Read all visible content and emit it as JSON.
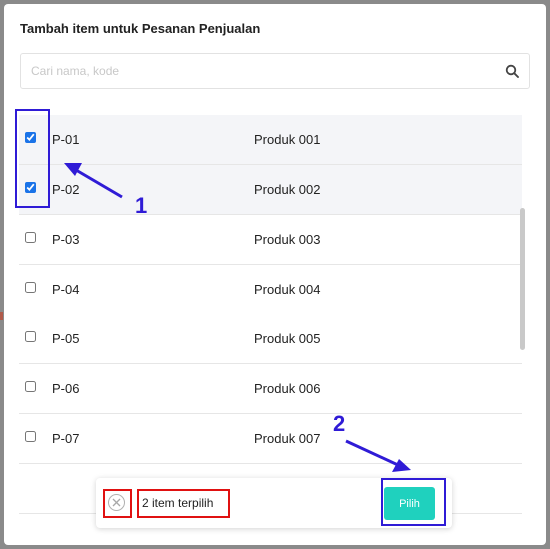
{
  "modal": {
    "title": "Tambah item untuk Pesanan Penjualan",
    "search": {
      "placeholder": "Cari nama, kode",
      "value": ""
    },
    "search_icon": "search-icon"
  },
  "items": [
    {
      "code": "P-01",
      "name": "Produk 001",
      "checked": true
    },
    {
      "code": "P-02",
      "name": "Produk 002",
      "checked": true
    },
    {
      "code": "P-03",
      "name": "Produk 003",
      "checked": false
    },
    {
      "code": "P-04",
      "name": "Produk 004",
      "checked": false
    },
    {
      "code": "P-05",
      "name": "Produk 005",
      "checked": false
    },
    {
      "code": "P-06",
      "name": "Produk 006",
      "checked": false
    },
    {
      "code": "P-07",
      "name": "Produk 007",
      "checked": false
    }
  ],
  "footer": {
    "clear_icon": "close-circle-icon",
    "selected_text": "2 item terpilih",
    "select_button": "Pilih"
  },
  "annotations": {
    "step1": "1",
    "step2": "2",
    "colors": {
      "blue": "#2f1bd6",
      "red": "#e01111"
    }
  },
  "colors": {
    "accent": "#1fd1be",
    "checkbox": "#1a73e8",
    "selected_row": "#f4f5f8"
  }
}
